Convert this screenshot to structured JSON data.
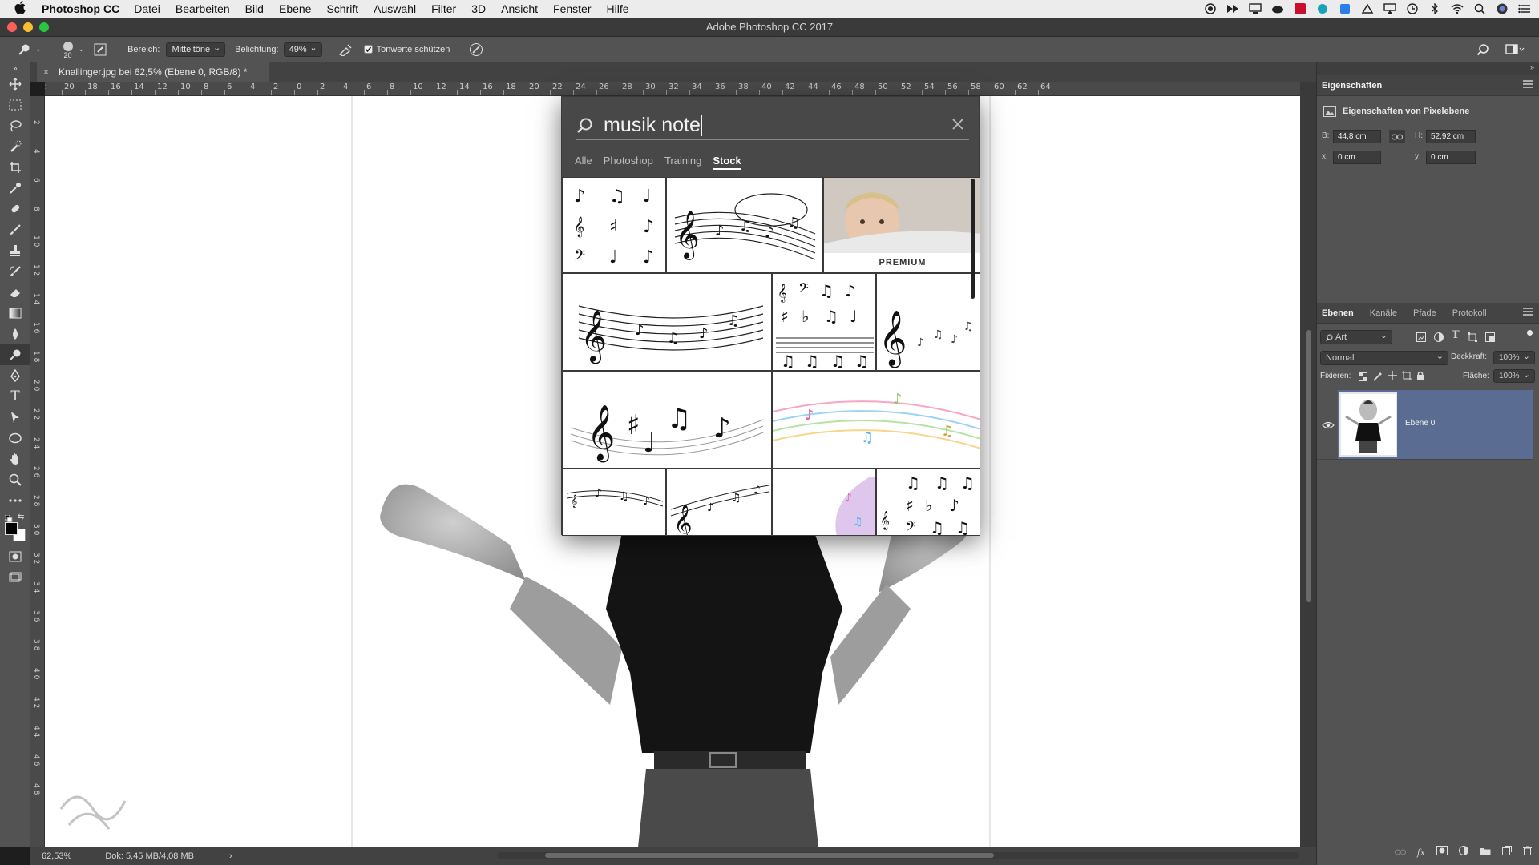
{
  "menubar": {
    "app_name": "Photoshop CC",
    "items": [
      "Datei",
      "Bearbeiten",
      "Bild",
      "Ebene",
      "Schrift",
      "Auswahl",
      "Filter",
      "3D",
      "Ansicht",
      "Fenster",
      "Hilfe"
    ]
  },
  "window": {
    "title": "Adobe Photoshop CC 2017"
  },
  "options_bar": {
    "brush_size": "20",
    "range_label": "Bereich:",
    "range_value": "Mitteltöne",
    "exposure_label": "Belichtung:",
    "exposure_value": "49%",
    "protect_tones_label": "Tonwerte schützen",
    "protect_tones_checked": true
  },
  "document": {
    "tab_title": "Knallinger.jpg bei 62,5% (Ebene 0, RGB/8) *",
    "close_glyph": "×"
  },
  "rulers": {
    "horizontal": [
      "2",
      "20",
      "18",
      "16",
      "14",
      "12",
      "10",
      "8",
      "6",
      "4",
      "2",
      "0",
      "2",
      "4",
      "6",
      "8",
      "10",
      "12",
      "14",
      "16",
      "18",
      "20",
      "22",
      "24",
      "26",
      "28",
      "30",
      "32",
      "34",
      "36",
      "38",
      "40",
      "42",
      "44",
      "46",
      "48",
      "50",
      "52",
      "54",
      "56",
      "58",
      "60",
      "62",
      "64"
    ],
    "vertical": [
      "0",
      "2",
      "4",
      "6",
      "8",
      "1 0",
      "1 2",
      "1 4",
      "1 6",
      "1 8",
      "2 0",
      "2 2",
      "2 4",
      "2 6",
      "2 8",
      "3 0",
      "3 2",
      "3 4",
      "3 6",
      "3 8",
      "4 0",
      "4 2",
      "4 4",
      "4 6",
      "4 8"
    ]
  },
  "status_bar": {
    "zoom": "62,53%",
    "doc_size": "Dok: 5,45 MB/4,08 MB",
    "arrow": "›"
  },
  "search_panel": {
    "query": "musik note",
    "tabs": [
      "Alle",
      "Photoshop",
      "Training",
      "Stock"
    ],
    "active_tab": "Stock",
    "premium_label": "PREMIUM"
  },
  "properties_panel": {
    "tab": "Eigenschaften",
    "subtitle": "Eigenschaften von Pixelebene",
    "w_label": "B:",
    "w_value": "44,8 cm",
    "h_label": "H:",
    "h_value": "52,92 cm",
    "x_label": "x:",
    "x_value": "0 cm",
    "y_label": "y:",
    "y_value": "0 cm"
  },
  "layers_panel": {
    "tabs": [
      "Ebenen",
      "Kanäle",
      "Pfade",
      "Protokoll"
    ],
    "active_tab": "Ebenen",
    "filter_kind": "Art",
    "blend_mode": "Normal",
    "opacity_label": "Deckkraft:",
    "opacity_value": "100%",
    "lock_label": "Fixieren:",
    "fill_label": "Fläche:",
    "fill_value": "100%",
    "layers": [
      {
        "name": "Ebene 0",
        "visible": true,
        "selected": true
      }
    ]
  },
  "colors": {
    "panel_bg": "#535353",
    "selected_layer": "#5a6c92",
    "menubar_bg": "#ececec"
  }
}
